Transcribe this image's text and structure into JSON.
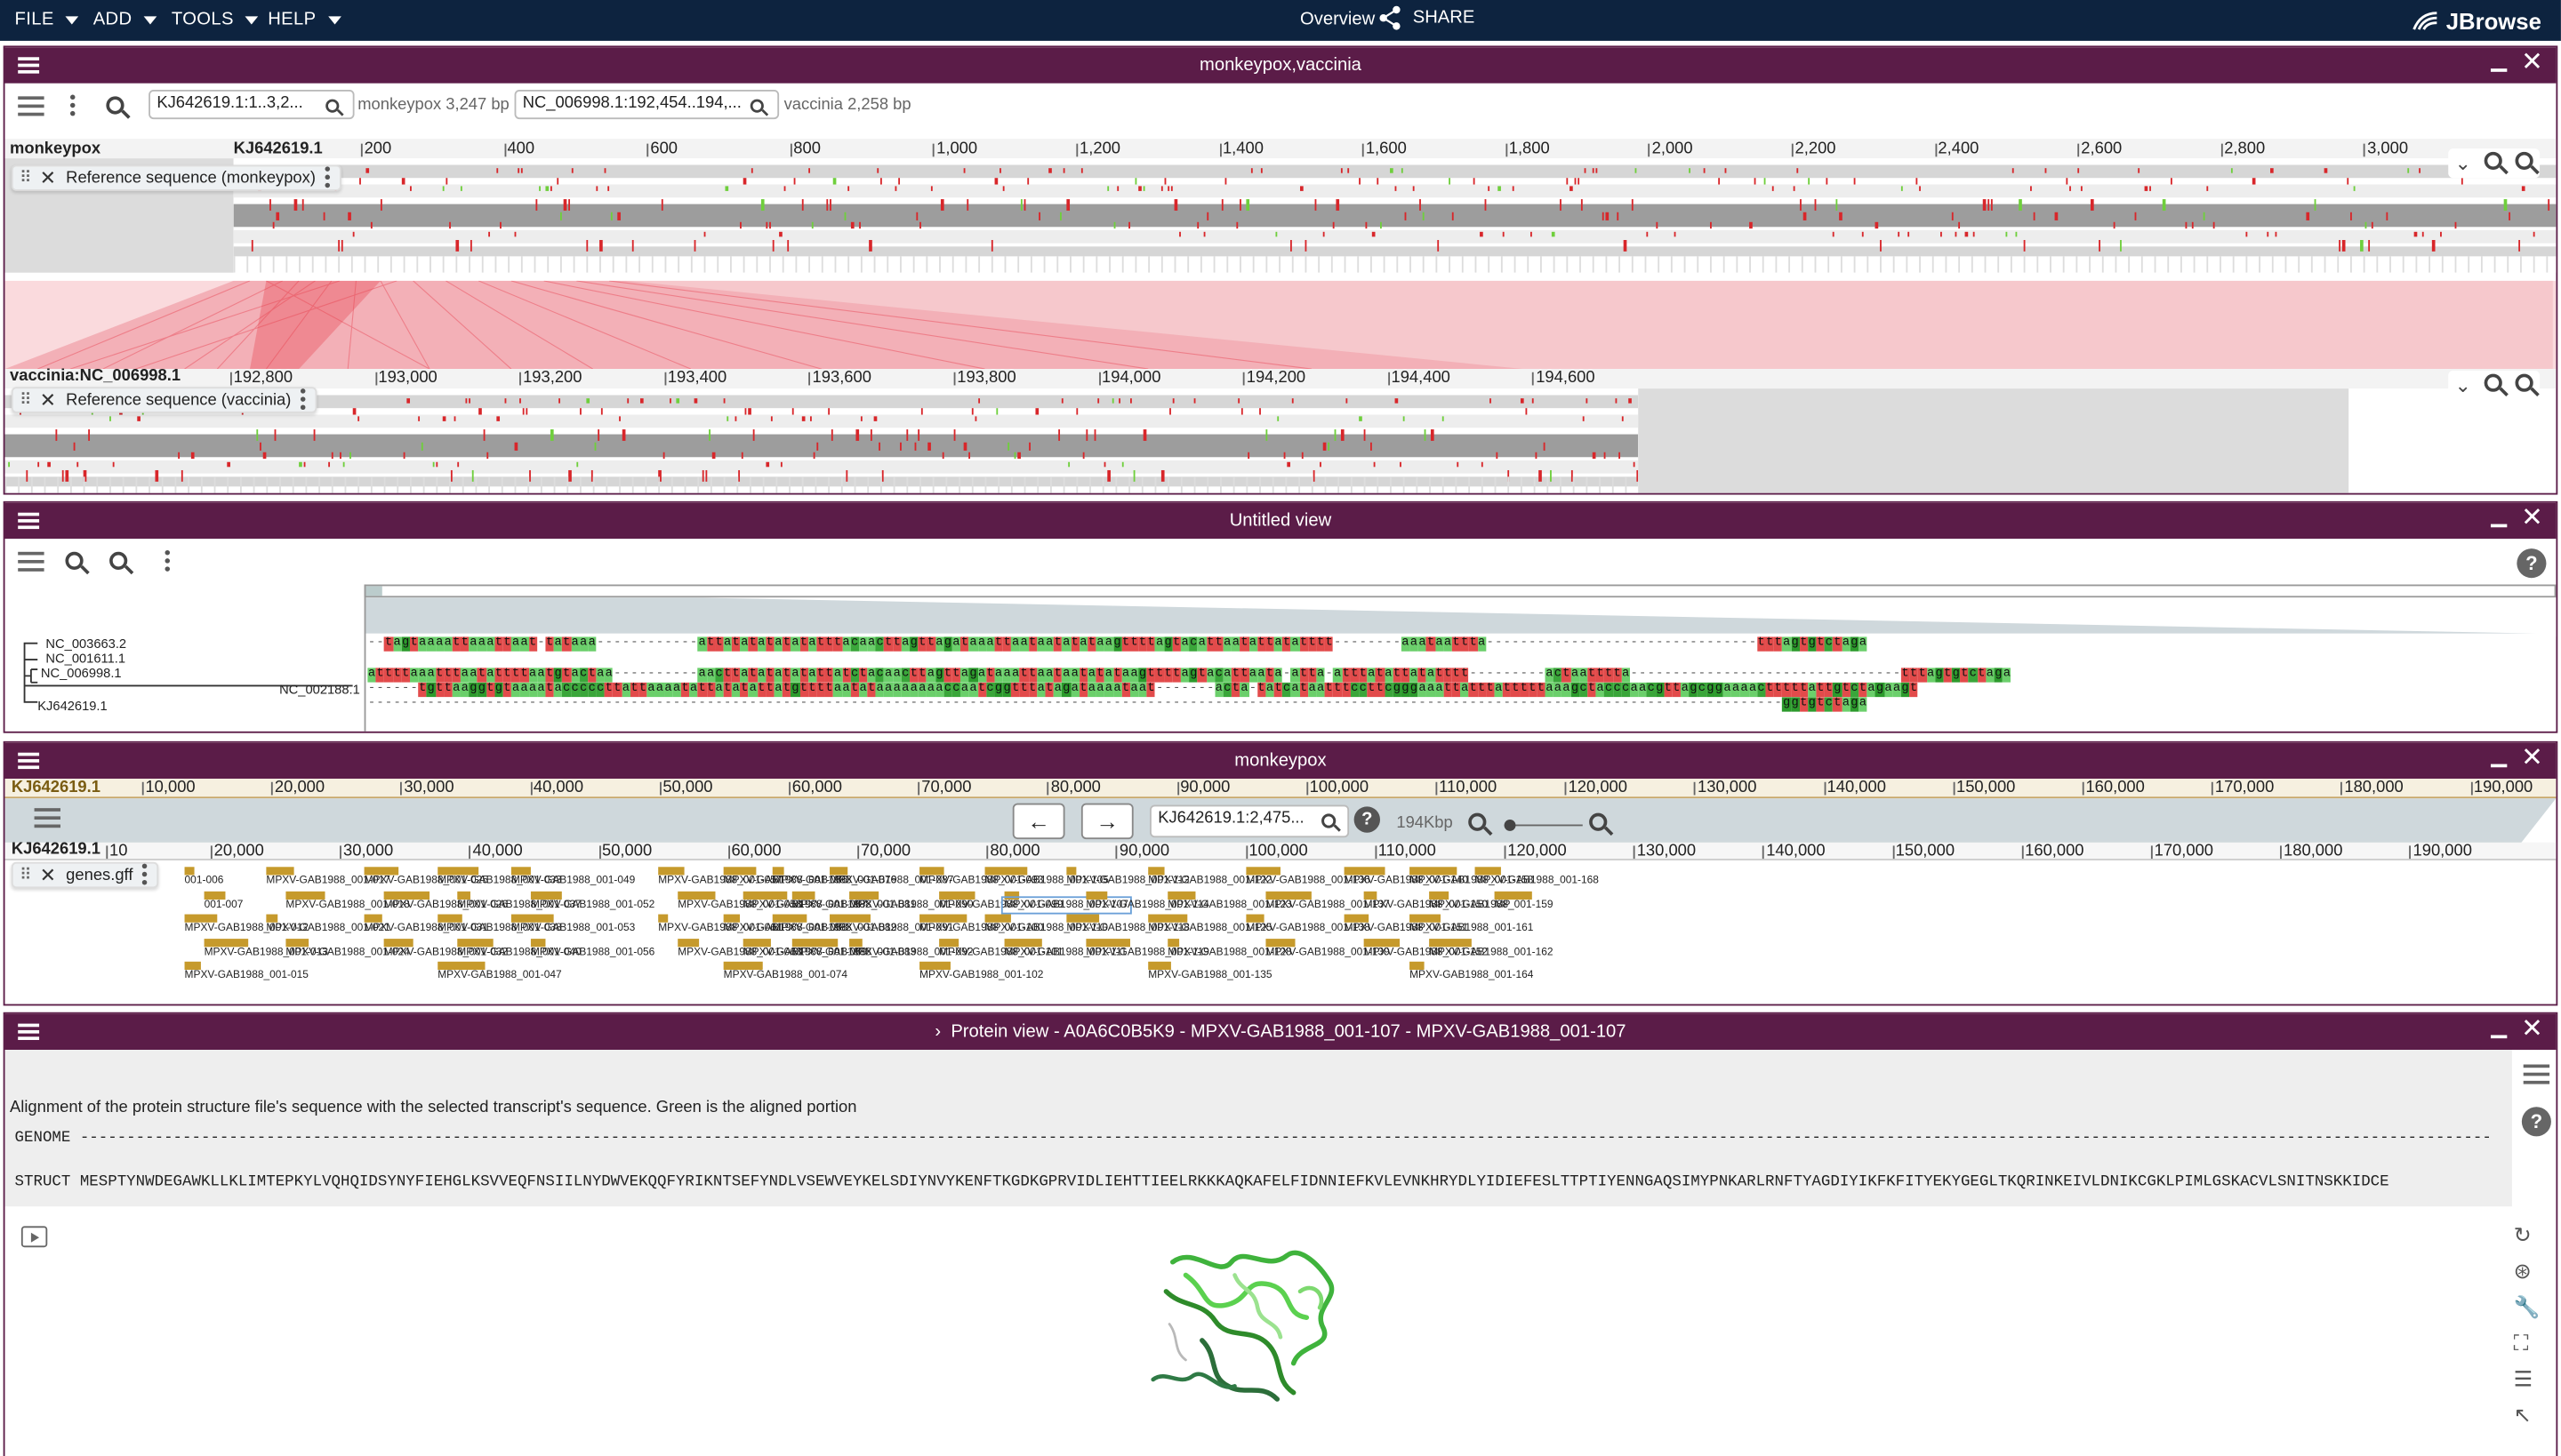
{
  "topbar": {
    "menus": [
      "FILE",
      "ADD",
      "TOOLS",
      "HELP"
    ],
    "overview": "Overview",
    "share": "SHARE",
    "brand": "JBrowse"
  },
  "synteny_view": {
    "title": "monkeypox,vaccinia",
    "search1": "KJ642619.1:1..3,2...",
    "info1": "monkeypox 3,247 bp",
    "search2": "NC_006998.1:192,454..194,...",
    "info2": "vaccinia 2,258 bp",
    "row1": {
      "label": "monkeypox",
      "ref": "KJ642619.1",
      "ticks": [
        "200",
        "400",
        "600",
        "800",
        "1,000",
        "1,200",
        "1,400",
        "1,600",
        "1,800",
        "2,000",
        "2,200",
        "2,400",
        "2,600",
        "2,800",
        "3,000"
      ],
      "track": "Reference sequence (monkeypox)"
    },
    "row2": {
      "label": "vaccinia",
      "ref": "NC_006998.1",
      "ticks": [
        "192,800",
        "193,000",
        "193,200",
        "193,400",
        "193,600",
        "193,800",
        "194,000",
        "194,200",
        "194,400",
        "194,600"
      ],
      "track": "Reference sequence (vaccinia)"
    }
  },
  "msa_view": {
    "title": "Untitled view",
    "tree": [
      "NC_003663.2",
      "NC_001611.1",
      "NC_006998.1",
      "NC_002188.1",
      "KJ642619.1"
    ],
    "rows": [
      "--tagtaaaattaaattaat-tataaa------------attatatatatatatttacaacttagttagataaattaataatatataagttttagtacattaatattatatttt--------aaataattta--------------------------------tttagtgtctaga",
      "attttaaatttaatattttaatgtactaa----------aacttatatatatattatctacaacttagttagataaattaataatatataagttttagtacattaata-atta-atttatattatatttt---------actaatttta--------------------------------tttagtgtctaga",
      "------tgttaaggtgtaaaatacccccttattaaaatattatatattatgttttaatataaaaaaaaccaatcggtttatagataaaataat-------acta-tatcataatttccttcgggaaattatttatttttaaagctacccaacgttagcggaaaactttttattgtctagaagt",
      "-----------------------------------------------------------------------------------------------------------------------------------------------------------------------ggtgtctaga"
    ]
  },
  "lgv_view": {
    "title": "monkeypox",
    "overview_ref": "KJ642619.1",
    "overview_ticks": [
      "10,000",
      "20,000",
      "30,000",
      "40,000",
      "50,000",
      "60,000",
      "70,000",
      "80,000",
      "90,000",
      "100,000",
      "110,000",
      "120,000",
      "130,000",
      "140,000",
      "150,000",
      "160,000",
      "170,000",
      "180,000",
      "190,000"
    ],
    "locus": "KJ642619.1:2,475...",
    "span": "194Kbp",
    "ref": "KJ642619.1",
    "ticks": [
      "10",
      "20,000",
      "30,000",
      "40,000",
      "50,000",
      "60,000",
      "70,000",
      "80,000",
      "90,000",
      "100,000",
      "110,000",
      "120,000",
      "130,000",
      "140,000",
      "150,000",
      "160,000",
      "170,000",
      "180,000",
      "190,000"
    ],
    "track": "genes.gff",
    "features": [
      "001-006",
      "001-007",
      "MPXV-GAB1988_001-012",
      "MPXV-GAB1988_001-013",
      "MPXV-GAB1988_001-015",
      "MPXV-GAB1988_001-017",
      "MPXV-GAB1988_001-018",
      "MPXV-GAB1988_001-021",
      "MPXV-GAB1988_001-024",
      "MPXV-GAB1988_001-025",
      "MPXV-GAB1988_001-026",
      "MPXV-GAB1988_001-031",
      "MPXV-GAB1988_001-032",
      "MPXV-GAB1988_001-033",
      "MPXV-GAB1988_001-037",
      "MPXV-GAB1988_001-038",
      "MPXV-GAB1988_001-040",
      "MPXV-GAB1988_001-047",
      "MPXV-GAB1988_001-049",
      "MPXV-GAB1988_001-052",
      "MPXV-GAB1988_001-053",
      "MPXV-GAB1988_001-056",
      "MPXV-GAB1988_001-057",
      "MPXV-GAB1988_001-058",
      "MPXV-GAB1988_001-061",
      "MPXV-GAB1988_001-063",
      "MPXV-GAB1988_001-066",
      "MPXV-GAB1988_001-067",
      "MPXV-GAB1988_001-068",
      "MPXV-GAB1988_001-069",
      "MPXV-GAB1988_001-074",
      "MPXV-GAB1988_001-076",
      "MPXV-GAB1988_001-081",
      "MPXV-GAB1988_001-082",
      "MPXV-GAB1988_001-083",
      "MPXV-GAB1988_001-087",
      "MPXV-GAB1988_001-090",
      "MPXV-GAB1988_001-091",
      "MPXV-GAB1988_001-092",
      "MPXV-GAB1988_001-093",
      "MPXV-GAB1988_001-099",
      "MPXV-GAB1988_001-100",
      "MPXV-GAB1988_001-101",
      "MPXV-GAB1988_001-102",
      "MPXV-GAB1988_001-105",
      "MPXV-GAB1988_001-107",
      "MPXV-GAB1988_001-110",
      "MPXV-GAB1988_001-111",
      "MPXV-GAB1988_001-112",
      "MPXV-GAB1988_001-114",
      "MPXV-GAB1988_001-118",
      "MPXV-GAB1988_001-119",
      "MPXV-GAB1988_001-122",
      "MPXV-GAB1988_001-123",
      "MPXV-GAB1988_001-125",
      "MPXV-GAB1988_001-128",
      "MPXV-GAB1988_001-135",
      "MPXV-GAB1988_001-136",
      "MPXV-GAB1988_001-137",
      "MPXV-GAB1988_001-138",
      "MPXV-GAB1988_001-139",
      "MPXV-GAB1988_001-140",
      "MPXV-GAB1988_001-150",
      "MPXV-GAB1988_001-151",
      "MPXV-GAB1988_001-152",
      "MPXV-GAB1988_001-158",
      "MPXV-GAB1988_001-159",
      "MPXV-GAB1988_001-161",
      "MPXV-GAB1988_001-162",
      "MPXV-GAB1988_001-164",
      "MPXV-GAB1988_001-168",
      "MP"
    ]
  },
  "protein_view": {
    "title": "Protein view - A0A6C0B5K9 - MPXV-GAB1988_001-107 - MPXV-GAB1988_001-107",
    "description": "Alignment of the protein structure file's sequence with the selected transcript's sequence. Green is the aligned portion",
    "genome_line": "GENOME -------------------------------------------------------------------------------------------------------------------------------------------------------------------------------------------------------------------------------------------------------------------",
    "struct_line": "STRUCT MESPTYNWDEGAWKLLKLIMTEPKYLVQHQIDSYNYFIEHGLKSVVEQFNSIILNYDWVEKQQFYRIKNTSEFYNDLVSEWVEYKELSDIYNVYKENFTKGDKGPRVIDLIEHTTIEELRKKKAQKAFELFIDNNIEFKVLEVNKHRYDLYIDIEFESLTTPTIYENNGAQSIMYPNKARLRNFTYAGDIYIKFKFITYEKYGEGLTKQRINKEIVLDNIKCGKLPIMLGSKACVLSNITNSKKIDCE"
  },
  "colors": {
    "topbar": "#0d233f",
    "view_header": "#5b1c48",
    "match": "#f3b1b8",
    "mismatch": "#e0242b",
    "feature": "#c69a2c",
    "protein": "#3fb33c"
  }
}
